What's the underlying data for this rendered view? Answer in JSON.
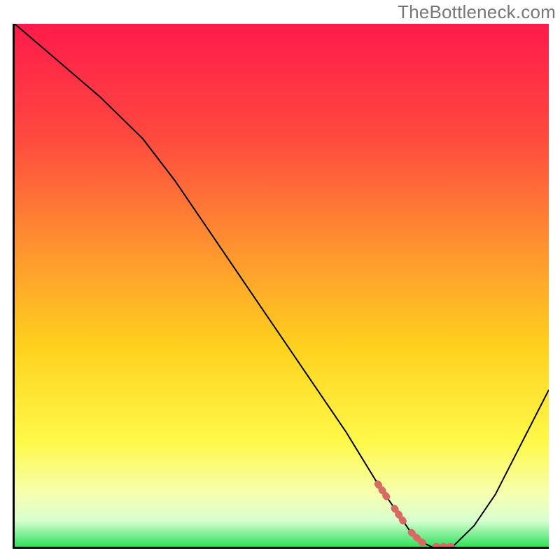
{
  "watermark": "TheBottleneck.com",
  "chart_data": {
    "type": "line",
    "title": "",
    "xlabel": "",
    "ylabel": "",
    "xlim": [
      0,
      100
    ],
    "ylim": [
      0,
      100
    ],
    "grid": false,
    "gradient_stops": [
      {
        "offset": 0.0,
        "color": "#ff1a4b"
      },
      {
        "offset": 0.22,
        "color": "#ff4a3f"
      },
      {
        "offset": 0.45,
        "color": "#ff9a2e"
      },
      {
        "offset": 0.62,
        "color": "#ffd21e"
      },
      {
        "offset": 0.8,
        "color": "#fff94a"
      },
      {
        "offset": 0.9,
        "color": "#f6ffb0"
      },
      {
        "offset": 0.95,
        "color": "#d8ffcf"
      },
      {
        "offset": 1.0,
        "color": "#30e060"
      }
    ],
    "series": [
      {
        "name": "bottleneck-curve",
        "stroke": "#000000",
        "width": 2,
        "x": [
          0,
          8,
          16,
          24,
          30,
          38,
          46,
          54,
          62,
          68,
          72,
          74,
          76,
          78,
          80,
          82,
          86,
          90,
          94,
          98,
          100
        ],
        "y": [
          100,
          93,
          86,
          78,
          70,
          58,
          46,
          34,
          22,
          12,
          6,
          3,
          1,
          0,
          0,
          0,
          4,
          10,
          18,
          26,
          30
        ]
      }
    ],
    "markers": {
      "name": "highlight-segment",
      "color": "#d86a63",
      "dash": [
        2,
        8,
        2,
        8,
        2,
        20
      ],
      "width": 10,
      "x": [
        68,
        72,
        74,
        76,
        78,
        80,
        82
      ],
      "y": [
        12,
        6,
        3,
        1,
        0,
        0,
        0
      ]
    }
  }
}
